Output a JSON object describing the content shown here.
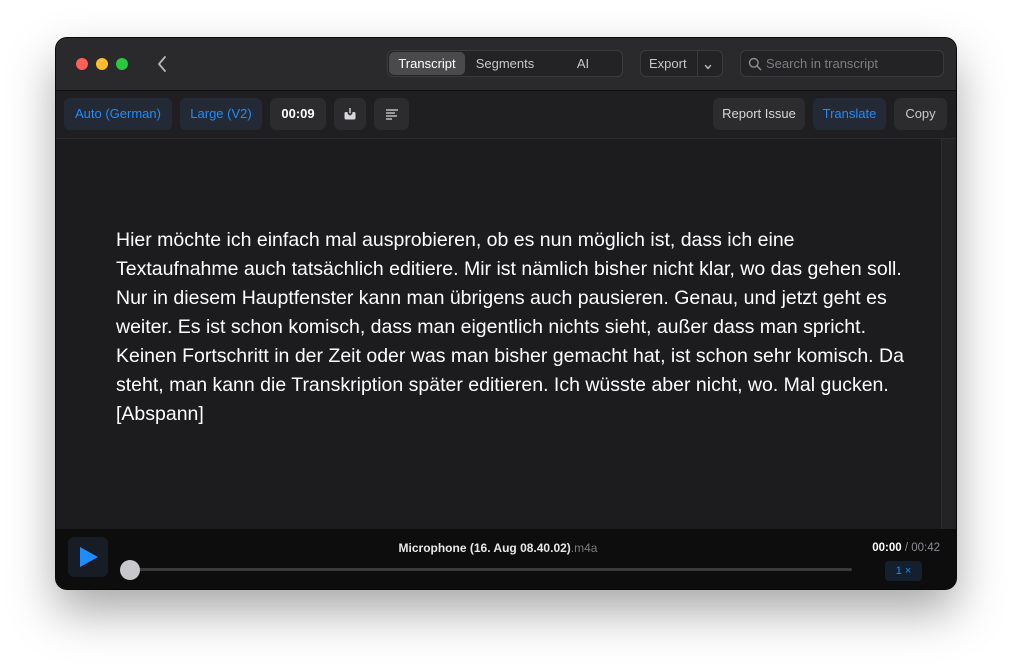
{
  "titlebar": {
    "tabs": [
      {
        "label": "Transcript",
        "active": true
      },
      {
        "label": "Segments",
        "active": false
      },
      {
        "label": "AI",
        "active": false
      }
    ],
    "export_label": "Export",
    "search": {
      "placeholder": "Search in transcript",
      "value": ""
    }
  },
  "toolbar": {
    "language_label": "Auto (German)",
    "model_label": "Large (V2)",
    "duration_label": "00:09",
    "report_issue_label": "Report Issue",
    "translate_label": "Translate",
    "copy_label": "Copy"
  },
  "transcript": {
    "text": "Hier möchte ich einfach mal ausprobieren, ob es nun möglich ist, dass ich eine Textaufnahme auch tatsächlich editiere. Mir ist nämlich bisher nicht klar, wo das gehen soll. Nur in diesem Hauptfenster kann man übrigens auch pausieren. Genau, und jetzt geht es weiter. Es ist schon komisch, dass man eigentlich nichts sieht, außer dass man spricht. Keinen Fortschritt in der Zeit oder was man bisher gemacht hat, ist schon sehr komisch. Da steht, man kann die Transkription später editieren. Ich wüsste aber nicht, wo. Mal gucken. [Abspann]"
  },
  "player": {
    "file_name": "Microphone (16. Aug 08.40.02)",
    "file_ext": ".m4a",
    "current_time": "00:00",
    "time_sep": " / ",
    "total_time": "00:42",
    "speed_label": "1 ×",
    "progress": 0
  },
  "colors": {
    "accent": "#1e8cff",
    "window_bg": "#1c1c1e",
    "close": "#ff5f57",
    "minimize": "#febc2e",
    "maximize": "#28c840"
  },
  "icons": {
    "back": "chevron-left-icon",
    "export_menu": "chevron-down-icon",
    "search": "magnifier-icon",
    "save": "download-tray-icon",
    "format": "text-align-left-icon",
    "play": "play-icon"
  }
}
